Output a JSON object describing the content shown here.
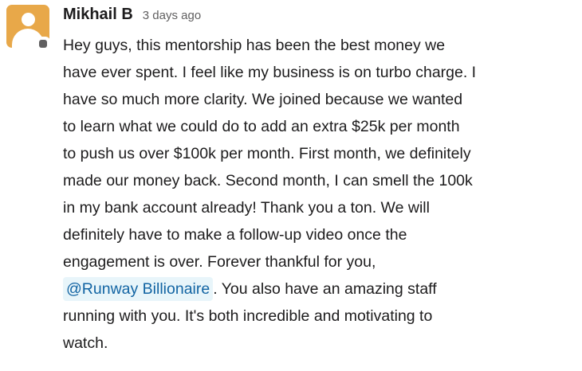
{
  "message": {
    "author": "Mikhail B",
    "timestamp": "3 days ago",
    "avatar_color": "#e8a849",
    "presence_color": "#616061",
    "mention_bg": "#e8f5fa",
    "mention_color": "#1264a3",
    "lines": [
      "Hey guys, this mentorship has been the best money we",
      "have ever spent.  I feel like my business is on turbo charge. I",
      "have so much more clarity. We joined because we wanted",
      "to learn what we could do to add an extra $25k per month",
      "to push us over $100k per month. First month, we definitely",
      "made our money back. Second month, I can smell the 100k",
      "in my bank account already! Thank you a ton. We will",
      "definitely have to make a follow-up video once the",
      "engagement is over. Forever thankful for you,"
    ],
    "mention": "@Runway Billionaire",
    "after_mention": ". You also have an amazing staff",
    "tail_lines": [
      "running with you. It's both incredible and motivating to",
      "watch."
    ]
  }
}
